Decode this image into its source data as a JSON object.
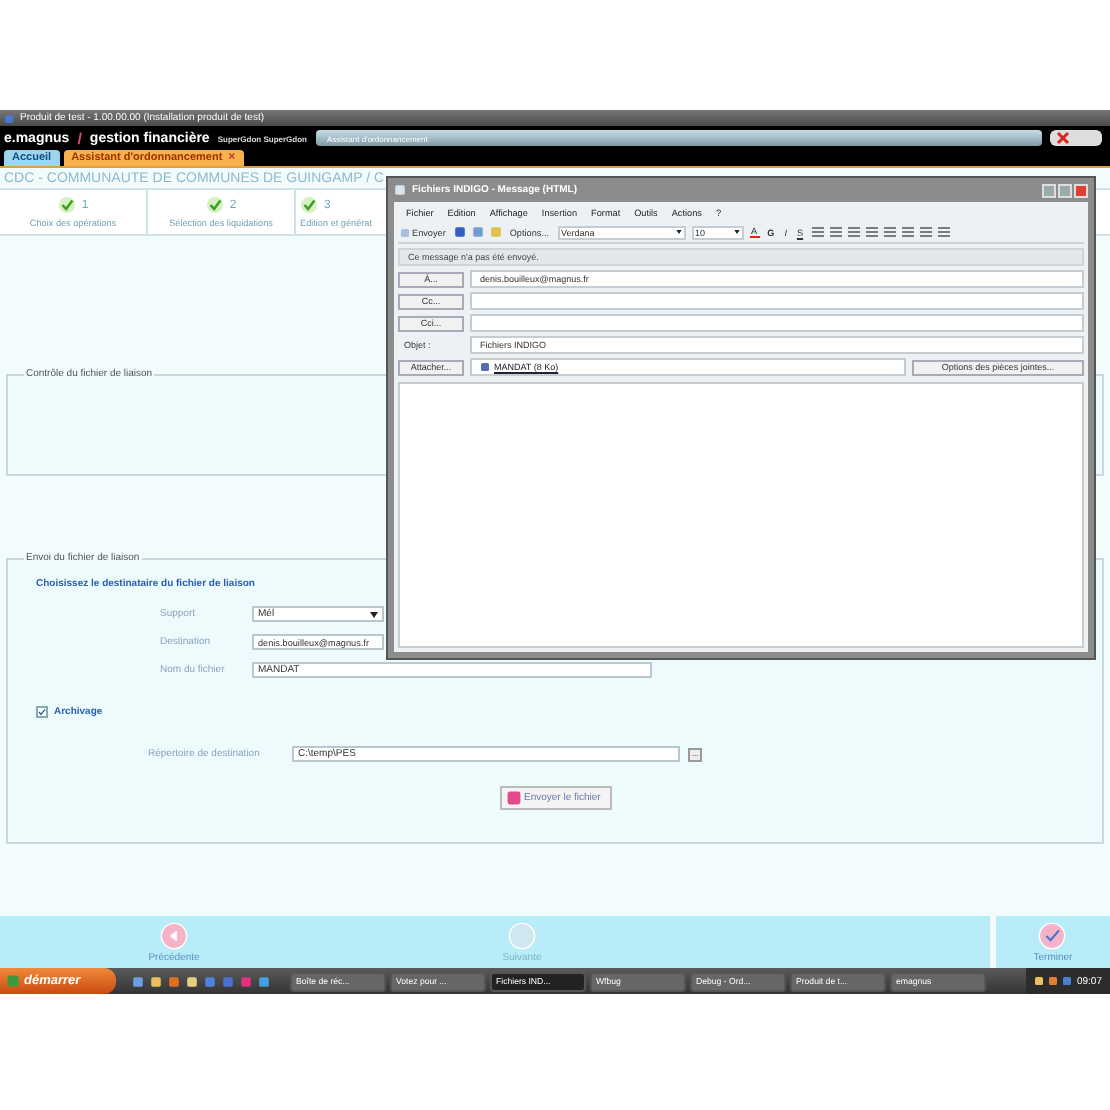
{
  "window": {
    "title": "Produit de test - 1.00.00.00 (Installation produit de test)"
  },
  "brand": {
    "name": "e.magnus",
    "slash": "/",
    "product": "gestion financière",
    "user": "SuperGdon SuperGdon",
    "context": "Assistant d'ordonnancement"
  },
  "tabs": [
    {
      "label": "Accueil",
      "selected": false,
      "closable": false
    },
    {
      "label": "Assistant d'ordonnancement",
      "selected": true,
      "closable": true,
      "close": "×"
    }
  ],
  "header": "CDC - COMMUNAUTE DE COMMUNES DE GUINGAMP / C",
  "steps": [
    {
      "number": "1",
      "label": "Choix des opérations",
      "done": true
    },
    {
      "number": "2",
      "label": "Sélection des liquidations",
      "done": true
    },
    {
      "number": "3",
      "label": "Edition et générat",
      "done": true
    }
  ],
  "control_section": {
    "legend": "Contrôle du fichier de liaison"
  },
  "send_section": {
    "legend": "Envoi du fichier de liaison",
    "heading": "Choisissez le destinataire du fichier de liaison",
    "fields": [
      {
        "label": "Support",
        "kind": "select",
        "value": "Mél"
      },
      {
        "label": "Destination",
        "kind": "text",
        "value": "denis.bouilleux@magnus.fr"
      },
      {
        "label": "Nom du fichier",
        "kind": "text",
        "value": "MANDAT"
      }
    ],
    "archive": {
      "label": "Archivage",
      "checked": true
    },
    "directory": {
      "label": "Répertoire de destination",
      "value": "C:\\temp\\PES",
      "browse": "..."
    },
    "send_button": "Envoyer le fichier"
  },
  "footer": [
    {
      "label": "Précédente",
      "kind": "back",
      "disabled": false
    },
    {
      "label": "Suivante",
      "kind": "next",
      "disabled": true
    },
    {
      "label": "Terminer",
      "kind": "finish",
      "disabled": false
    }
  ],
  "message_window": {
    "title": "Fichiers INDIGO - Message (HTML)",
    "menu": [
      "Fichier",
      "Edition",
      "Affichage",
      "Insertion",
      "Format",
      "Outils",
      "Actions",
      "?"
    ],
    "toolbar": {
      "send": "Envoyer",
      "options": "Options...",
      "font": "Verdana",
      "size": "10",
      "font_color": "A",
      "format": [
        "G",
        "I",
        "S"
      ]
    },
    "info": "Ce message n'a pas été envoyé.",
    "rows": [
      {
        "kind": "button",
        "label": "À...",
        "value": "denis.bouilleux@magnus.fr"
      },
      {
        "kind": "button",
        "label": "Cc...",
        "value": ""
      },
      {
        "kind": "button",
        "label": "Cci...",
        "value": ""
      },
      {
        "kind": "label",
        "label": "Objet :",
        "value": "Fichiers INDIGO"
      }
    ],
    "attach": {
      "label": "Attacher...",
      "file": "MANDAT (8 Ko)",
      "options": "Options des pièces jointes..."
    }
  },
  "taskbar": {
    "start": "démarrer",
    "tasks": [
      {
        "label": "Boîte de réc...",
        "selected": false
      },
      {
        "label": "Votez pour ...",
        "selected": false
      },
      {
        "label": "Fichiers IND...",
        "selected": true
      },
      {
        "label": "Wfbug",
        "selected": false
      },
      {
        "label": "Debug - Ord...",
        "selected": false
      },
      {
        "label": "Produit de t...",
        "selected": false
      },
      {
        "label": "emagnus",
        "selected": false
      }
    ],
    "clock": "09:07"
  }
}
